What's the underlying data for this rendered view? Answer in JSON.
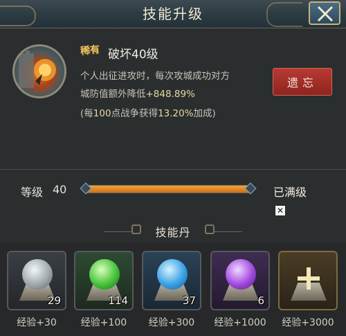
{
  "window": {
    "title": "技能升级"
  },
  "skill": {
    "rarity_badge": "稀有",
    "name_prefix": "破坏",
    "level_suffix": "40级",
    "desc_line1": "个人出征进攻时，每次攻城成功对方",
    "desc_line2_prefix": "城防值额外降低",
    "desc_line2_value": "+848.89%",
    "desc_line3_prefix": "(每",
    "desc_line3_num": "100",
    "desc_line3_mid": "点战争获得",
    "desc_line3_pct": "13.20%",
    "desc_line3_suffix": "加成)"
  },
  "actions": {
    "forget_label": "遗忘"
  },
  "level": {
    "label": "等级",
    "value": "40",
    "progress": 1.0,
    "status": "已满级",
    "checkbox_mark": "✕"
  },
  "pills_section": {
    "title": "技能丹",
    "items": [
      {
        "count": "29",
        "exp": "经验+30",
        "color": "#9fa9ae"
      },
      {
        "count": "114",
        "exp": "经验+100",
        "color": "#47c33c"
      },
      {
        "count": "37",
        "exp": "经验+300",
        "color": "#3aa2e6"
      },
      {
        "count": "6",
        "exp": "经验+1000",
        "color": "#a24ae0"
      },
      {
        "count": "",
        "exp": "经验+3000",
        "color": "#c9a24a"
      }
    ]
  },
  "colors": {
    "accent_gold": "#e8c468",
    "forget_red": "#a8302a",
    "bar_orange": "#e08a2a"
  }
}
